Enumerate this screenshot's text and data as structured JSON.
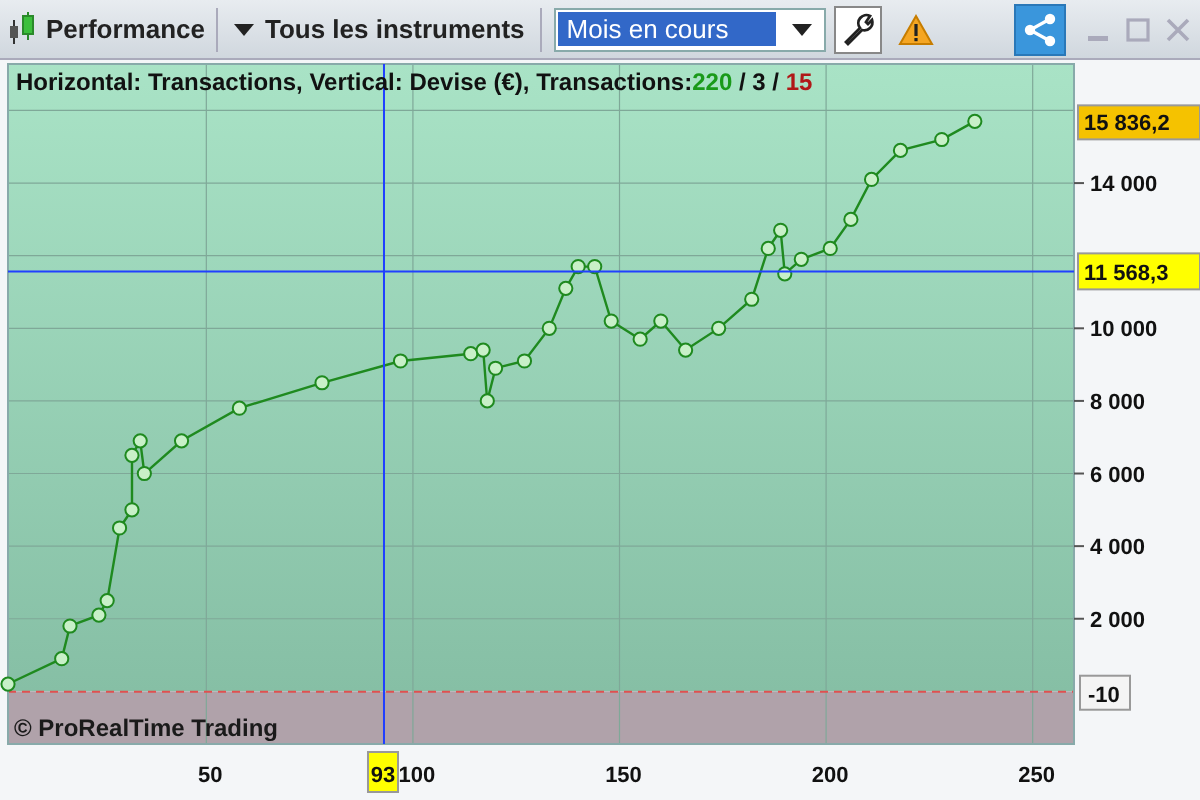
{
  "toolbar": {
    "title": "Performance",
    "instruments": "Tous les instruments",
    "period": {
      "value": "Mois en cours"
    }
  },
  "chart": {
    "header": {
      "text": "Horizontal: Transactions, Vertical: Devise (€), Transactions:",
      "counts": [
        {
          "value": "220",
          "color": "#1a9a1a"
        },
        {
          "value": "3",
          "color": "#111111"
        },
        {
          "value": "15",
          "color": "#b01818"
        }
      ],
      "separators": [
        "/",
        "/"
      ]
    },
    "copyright": "© ProRealTime Trading",
    "last_value": "15 836,2",
    "crosshair": {
      "x_label": "93",
      "y_label": "11 568,3"
    },
    "zero_label": "-10",
    "chart_data": {
      "type": "line",
      "grid": true,
      "xlim": [
        2,
        260
      ],
      "ylim": [
        -1450,
        17280
      ],
      "xticks": [
        50,
        100,
        150,
        200,
        250
      ],
      "yticks": [
        {
          "value": 2000,
          "label": "2 000"
        },
        {
          "value": 4000,
          "label": "4 000"
        },
        {
          "value": 6000,
          "label": "6 000"
        },
        {
          "value": 8000,
          "label": "8 000"
        },
        {
          "value": 10000,
          "label": "10 000"
        },
        {
          "value": 14000,
          "label": "14 000"
        }
      ],
      "ref_lines": [
        {
          "axis": "y",
          "value": -10
        },
        {
          "axis": "y",
          "value": 11568
        },
        {
          "axis": "x",
          "value": 93
        }
      ],
      "x": [
        2,
        15,
        17,
        24,
        26,
        29,
        32,
        32,
        34,
        35,
        44,
        58,
        78,
        97,
        114,
        117,
        118,
        120,
        127,
        133,
        137,
        140,
        144,
        148,
        155,
        160,
        166,
        174,
        182,
        186,
        189,
        190,
        194,
        201,
        206,
        211,
        218,
        228,
        236
      ],
      "series": [
        {
          "color": "#1f8a1f",
          "marker": "o",
          "values": [
            200,
            900,
            1800,
            2100,
            2500,
            4500,
            5000,
            6500,
            6900,
            6000,
            6900,
            7800,
            8500,
            9100,
            9300,
            9400,
            8000,
            8900,
            9100,
            10000,
            11100,
            11700,
            11700,
            10200,
            9700,
            10200,
            9400,
            10000,
            10800,
            12200,
            12700,
            11500,
            11900,
            12200,
            13000,
            14100,
            14900,
            15200,
            15700
          ]
        }
      ]
    }
  }
}
